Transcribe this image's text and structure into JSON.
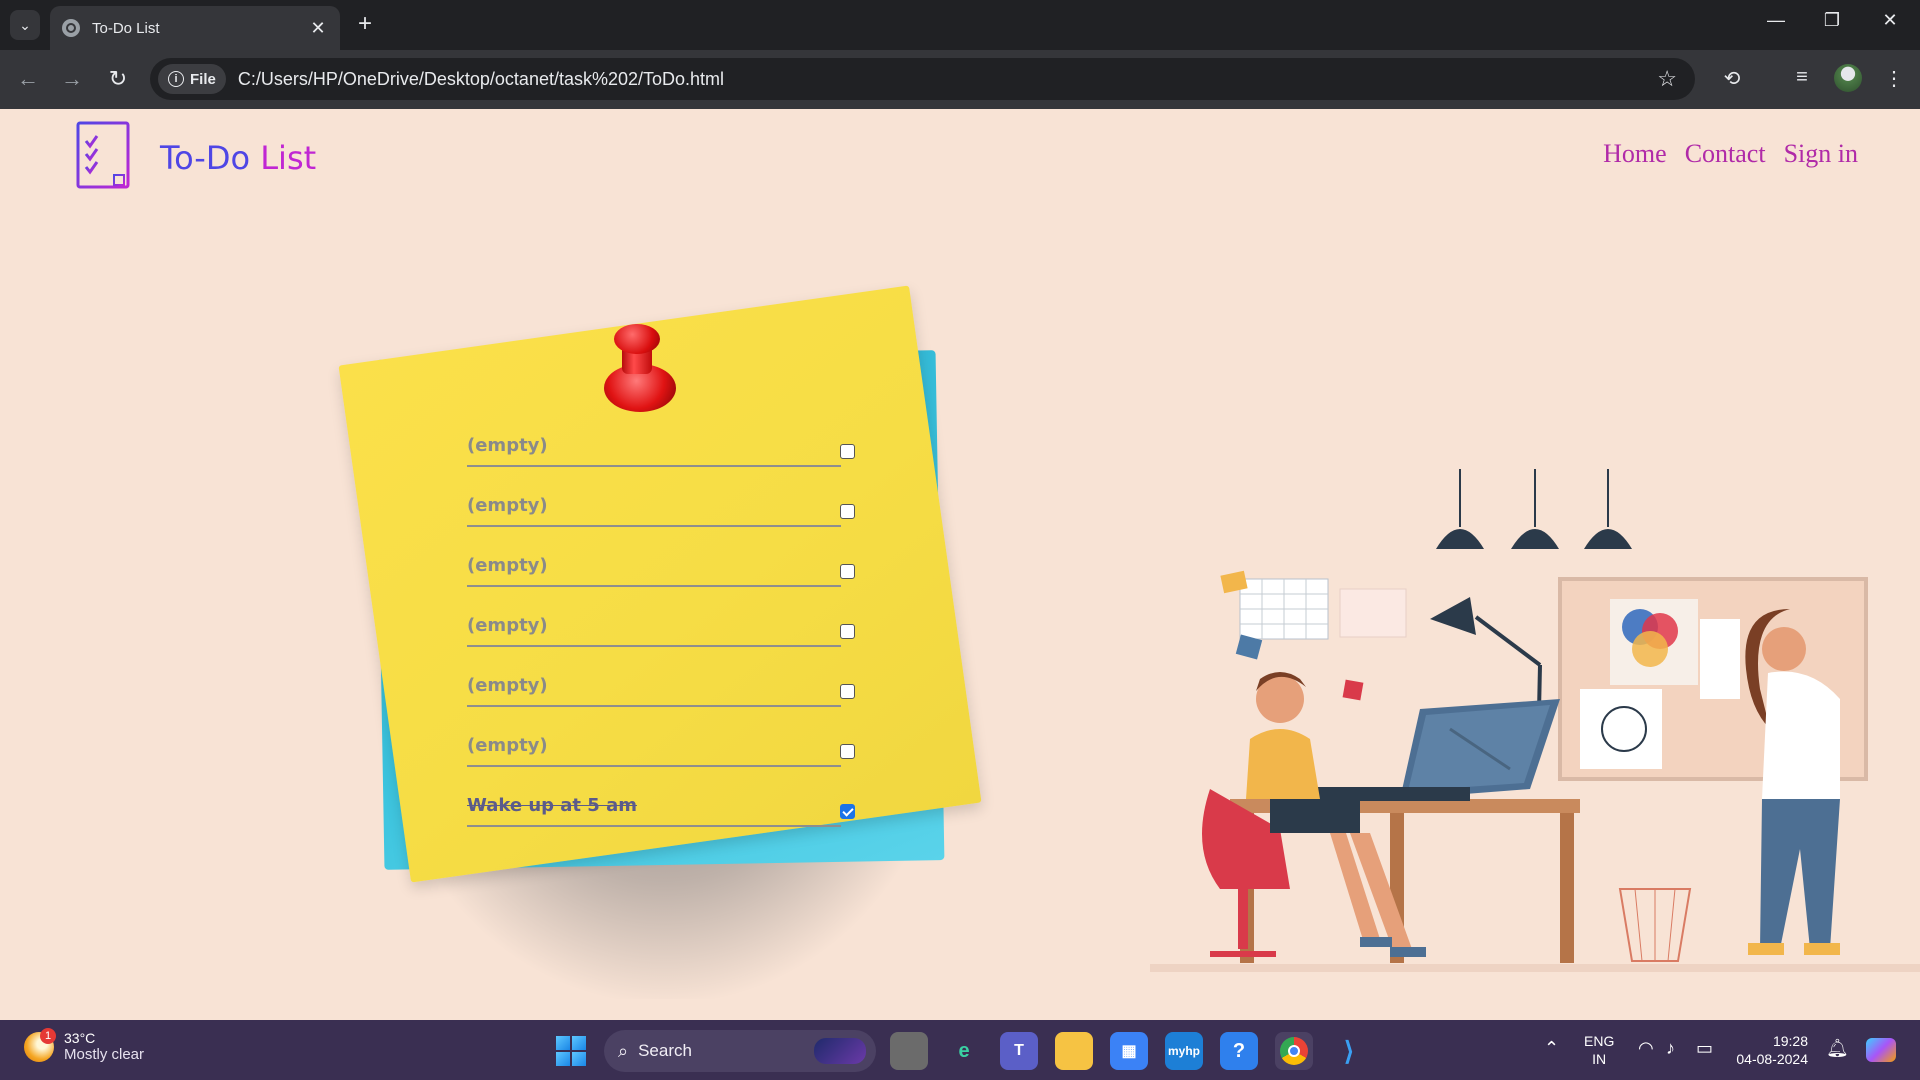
{
  "browser": {
    "tab_title": "To-Do List",
    "tab_close": "✕",
    "new_tab": "+",
    "file_chip": "File",
    "url": "C:/Users/HP/OneDrive/Desktop/octanet/task%202/ToDo.html"
  },
  "site": {
    "title_part1": "To-Do",
    "title_part2": "List",
    "nav": [
      "Home",
      "Contact",
      "Sign in"
    ]
  },
  "todos": [
    {
      "text": "(empty)",
      "checked": false
    },
    {
      "text": "(empty)",
      "checked": false
    },
    {
      "text": "(empty)",
      "checked": false
    },
    {
      "text": "(empty)",
      "checked": false
    },
    {
      "text": "(empty)",
      "checked": false
    },
    {
      "text": "(empty)",
      "checked": false
    },
    {
      "text": "Wake up at 5 am",
      "checked": true
    }
  ],
  "taskbar": {
    "weather_temp": "33°C",
    "weather_cond": "Mostly clear",
    "weather_badge": "1",
    "search_label": "Search",
    "lang_line1": "ENG",
    "lang_line2": "IN",
    "time": "19:28",
    "date": "04-08-2024"
  },
  "colors": {
    "page_bg": "#f8e3d5",
    "title_blue": "#4f46e5",
    "title_purple": "#c026d3",
    "nav_link": "#b02aa8",
    "note_yellow": "#f6dd45",
    "note_blue": "#3cc4de"
  }
}
